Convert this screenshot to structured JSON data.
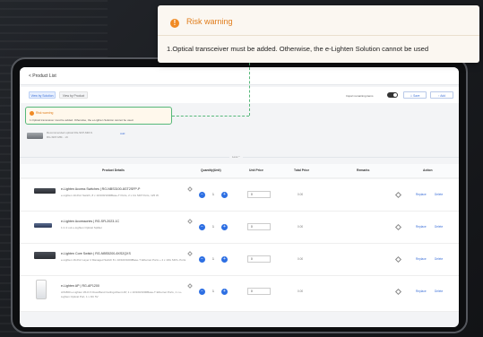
{
  "popup": {
    "title": "Risk warning",
    "message": "1.Optical transceiver must be added. Otherwise, the e-Lighten Solution cannot be used"
  },
  "header": {
    "back_label": "< Product List"
  },
  "tabs": [
    {
      "label": "View by Solution"
    },
    {
      "label": "View by Product"
    }
  ],
  "toolbar": {
    "toggle_label": "Import remaining items",
    "btn1_label": "⇩ Save",
    "btn2_label": "↑ Add"
  },
  "inline_warning": {
    "title": "Risk warning",
    "message": "1.Optical transceiver must be added. Otherwise, the e-Lighten Solution cannot be used."
  },
  "transceiver": {
    "line1": "Recommended optical   RG-SFP-MM-S",
    "line2": "RG-SFP-MM...   x6",
    "add_label": "Add"
  },
  "collapse_label": "Less ^",
  "table": {
    "headers": [
      "Product Details",
      "Quantity(Unit)",
      "Unit Price",
      "Total Price",
      "Remarks",
      "Action"
    ],
    "rows": [
      {
        "name": "e-Lighten Access Switches | RG-NBS3100-8GT2SFP-P",
        "desc": "e-Lighten 10-Port Switch, 8 x 10/100/1000Base-T Ports, 2 x 1G SFP Ports, 125 W.",
        "qty": "1",
        "price": "0",
        "total": "0.00",
        "action_replace": "Replace",
        "action_delete": "Delete"
      },
      {
        "name": "e-Lighten Accessories | RG-SFL2023-1C",
        "desc": "1 in 2 out e-Lighten Optical Splitter",
        "qty": "1",
        "price": "0",
        "total": "0.00",
        "action_replace": "Replace",
        "action_delete": "Delete"
      },
      {
        "name": "e-Lighten Core Switch | RG-NBS5200-8XS2QXS",
        "desc": "e-Lighten 16-Port Layer 2 Managed Switch 8 x 10/100/1000Base-T Ethernet Ports + 4 x 10G SFP+ Ports",
        "qty": "1",
        "price": "0",
        "total": "0.00",
        "action_replace": "Replace",
        "action_delete": "Delete"
      },
      {
        "name": "e-Lighten AP | RG-AP1200",
        "desc": "AX1800 e-Lighten Wi-Fi 6 Dual-Band Ceiling-Mount AP, 1 x 10/100/1000Base-T Ethernet Ports, 1 x e-Lighten Optical Port, 1 x DC 5V",
        "qty": "1",
        "price": "0",
        "total": "0.00",
        "action_replace": "Replace",
        "action_delete": "Delete"
      }
    ]
  },
  "colors": {
    "accent": "#2d6fe3",
    "warning": "#f08a24",
    "highlight": "#56b87a"
  }
}
